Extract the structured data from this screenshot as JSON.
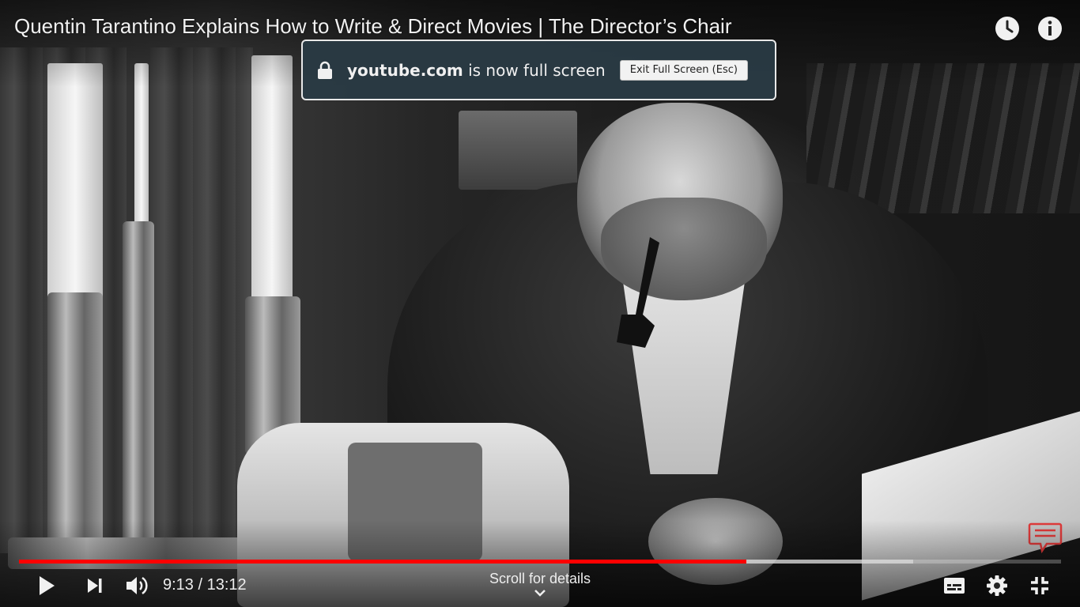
{
  "video": {
    "title": "Quentin Tarantino Explains How to Write & Direct Movies | The Director’s Chair"
  },
  "top_buttons": [
    {
      "name": "watch-later",
      "icon": "clock-icon"
    },
    {
      "name": "info",
      "icon": "info-icon"
    }
  ],
  "fullscreen_notice": {
    "domain": "youtube.com",
    "message": " is now full screen",
    "exit_label": "Exit Full Screen (Esc)",
    "icon": "lock-icon"
  },
  "player": {
    "current_time": "9:13",
    "duration": "13:12",
    "time_display": "9:13 / 13:12",
    "played_fraction": 0.698,
    "buffered_fraction": 0.858,
    "scroll_hint": "Scroll for details",
    "accent_color": "#ff0000",
    "controls": [
      "play-icon",
      "next-icon",
      "volume-icon",
      "subtitles-icon",
      "settings-icon",
      "exit-fullscreen-icon"
    ]
  }
}
